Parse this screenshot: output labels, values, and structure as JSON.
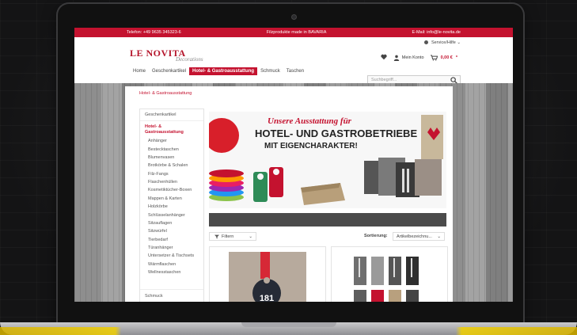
{
  "topbar": {
    "phone": "Telefon: +49 9635 345323-6",
    "tagline": "Filzprodukte made in BAVARIA",
    "email": "E-Mail: info@le-novita.de"
  },
  "header": {
    "logo": "LE NOVITA",
    "logo_sub": "Decorations",
    "service": "Service/Hilfe",
    "account": "Mein Konto",
    "cart_price": "0,00 €",
    "search_placeholder": "Suchbegriff..."
  },
  "nav": {
    "items": [
      "Home",
      "Geschenkartikel",
      "Hotel- & Gastroausstattung",
      "Schmuck",
      "Taschen"
    ],
    "active_index": 2
  },
  "breadcrumb": "Hotel- & Gastroausstattung",
  "sidebar": {
    "head": "Geschenkartikel",
    "active": "Hotel- & Gastroausstattung",
    "items": [
      "Anhänger",
      "Bestecktaschen",
      "Blumenvasen",
      "Brotkörbe & Schalen",
      "Filz-Fangs",
      "Flaschenhüllen",
      "Kosmetiktücher-Boxen",
      "Mappen & Karten",
      "Holzkörbe",
      "Schlüsselanhänger",
      "Sitzauflagen",
      "Sitzwürfel",
      "Tierbedarf",
      "Türanhänger",
      "Untersetzer & Tischsets",
      "Wärmflaschen",
      "Wellnesstaschen"
    ],
    "footer": "Schmuck"
  },
  "banner": {
    "line1": "Unsere Ausstattung für",
    "line2": "HOTEL- UND GASTROBETRIEBE",
    "line3": "MIT EIGENCHARAKTER!"
  },
  "listing": {
    "filter_label": "Filtern",
    "sort_label": "Sortierung:",
    "sort_value": "Artikelbezeichnu..."
  },
  "products": [
    {
      "tag": "181"
    },
    {
      "tag": ""
    }
  ],
  "colors": {
    "brand_red": "#c4122f"
  }
}
